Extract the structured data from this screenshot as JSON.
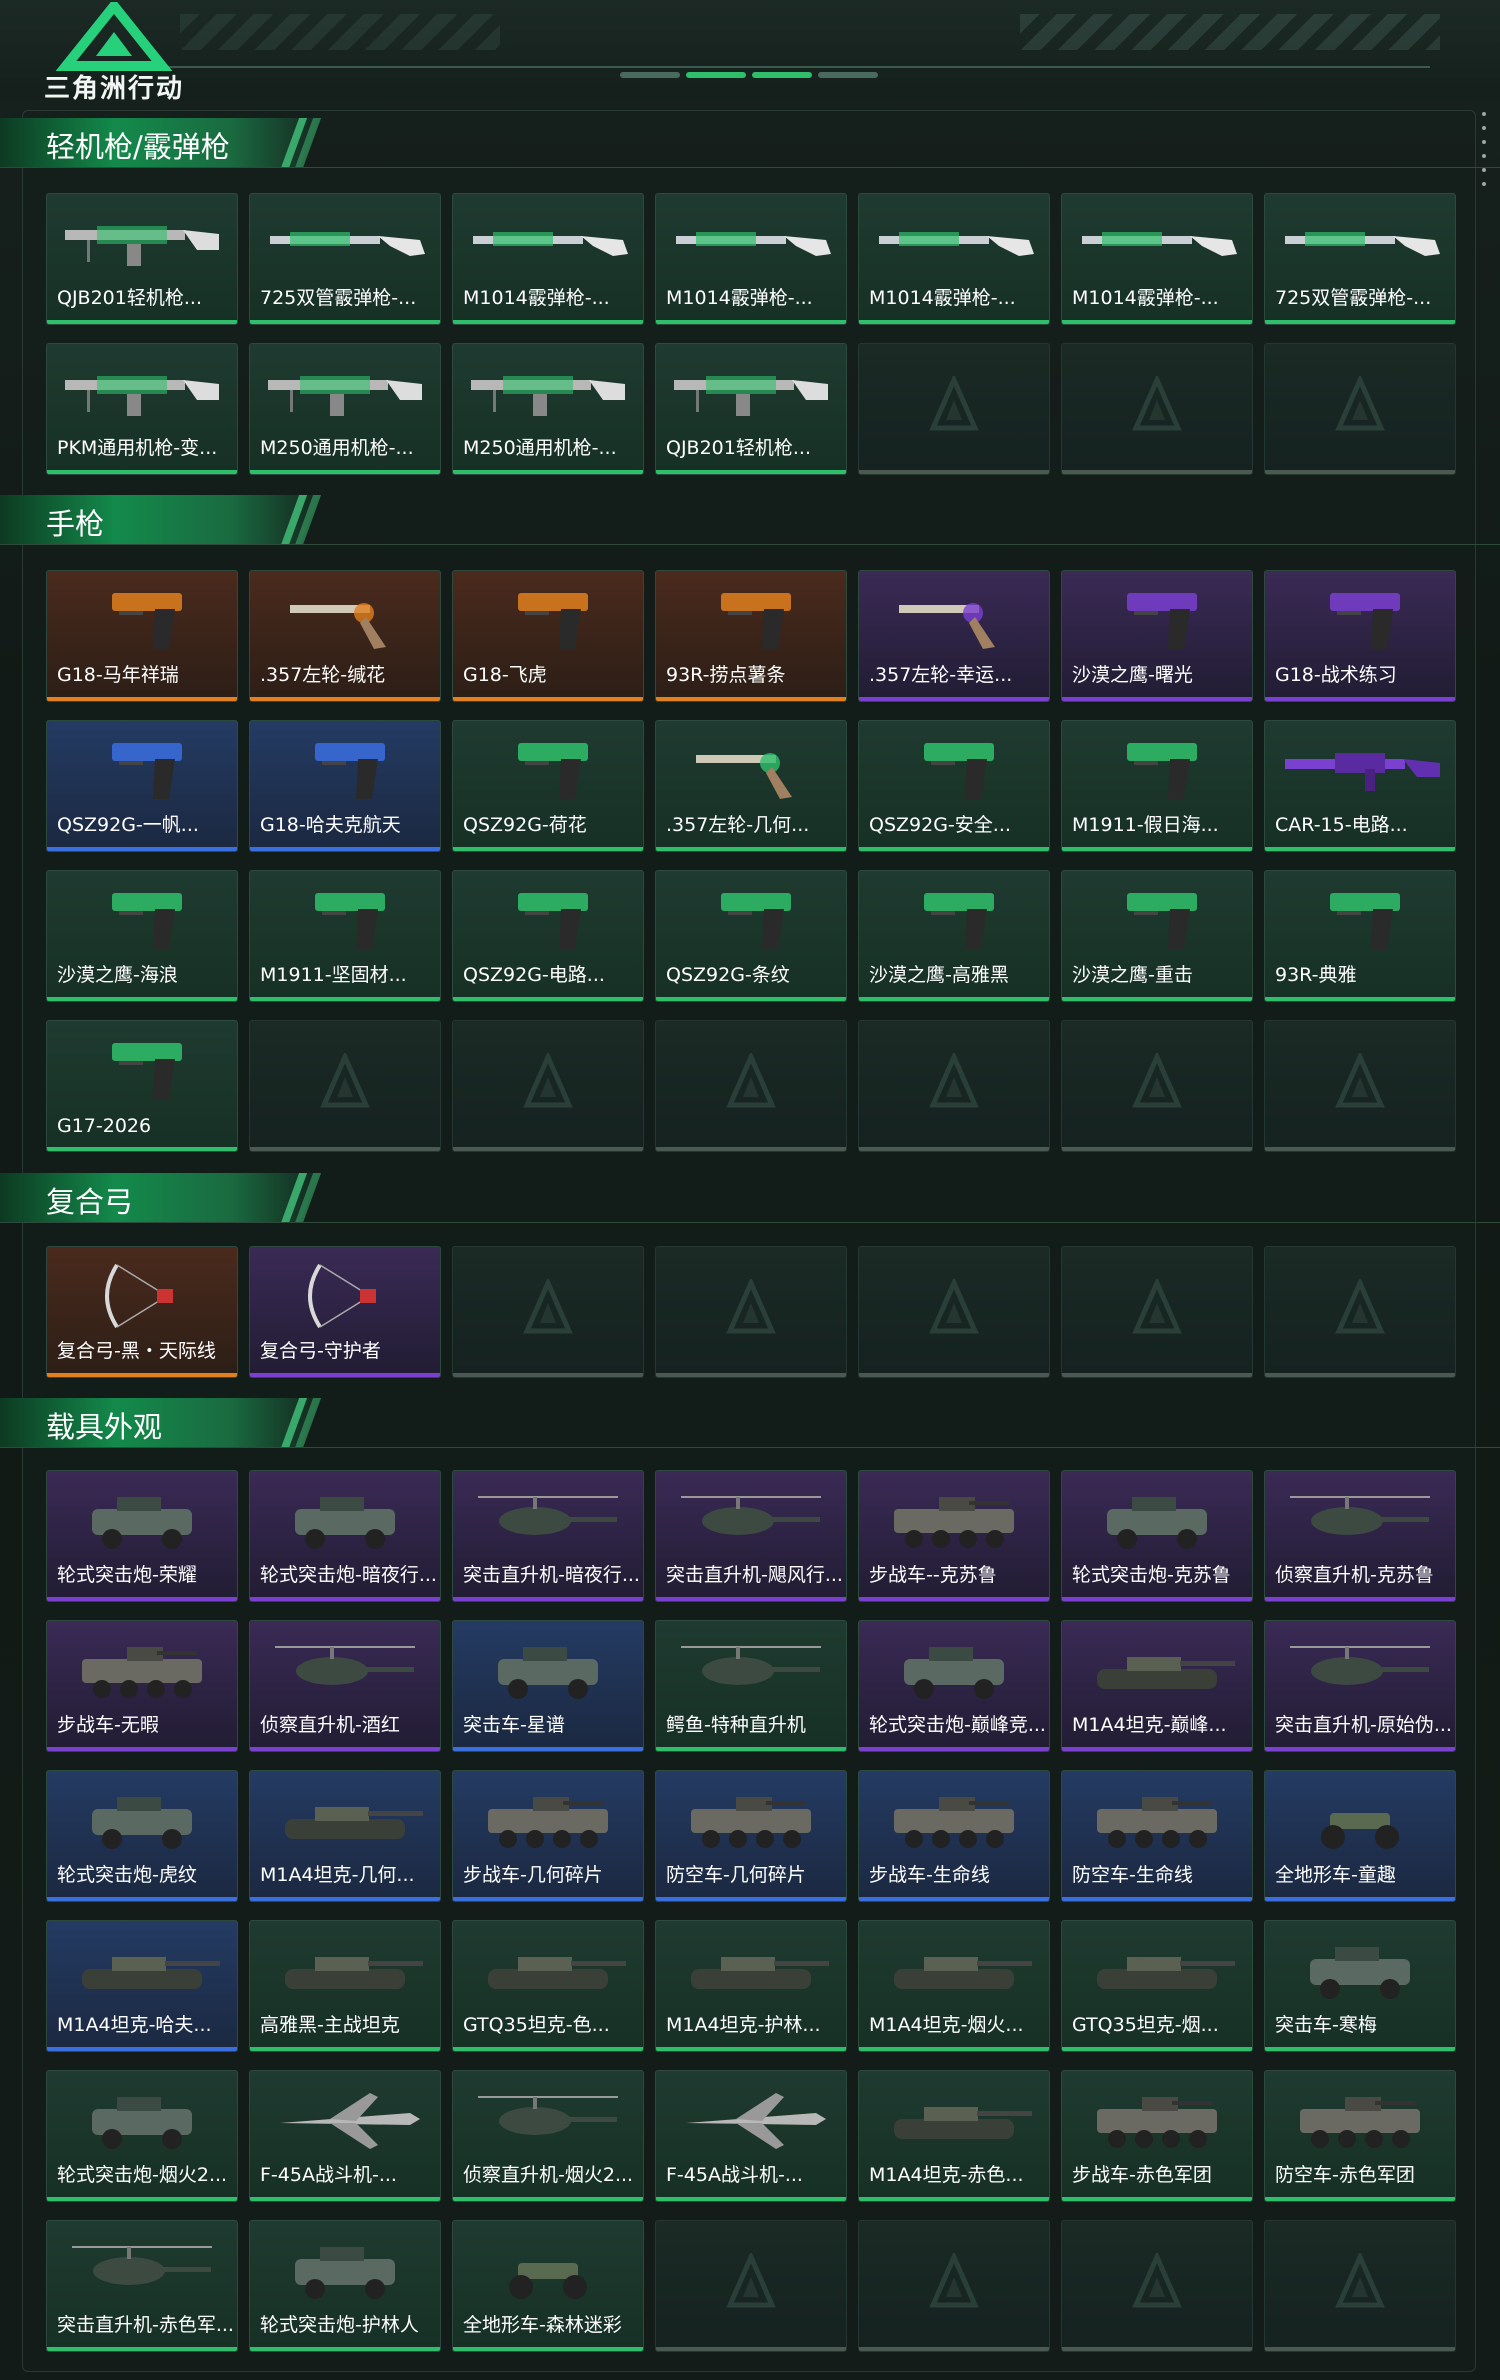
{
  "header": {
    "logo_text": "三角洲行动"
  },
  "colors": {
    "green": "#2fbf6b",
    "orange": "#e0801e",
    "purple": "#7a40d0",
    "blue": "#3a6fe0",
    "accent": "#138a4b"
  },
  "sections": [
    {
      "title": "轻机枪/霰弹枪",
      "items": [
        {
          "name": "QJB201轻机枪...",
          "rarity": "green",
          "kind": "lmg"
        },
        {
          "name": "725双管霰弹枪-...",
          "rarity": "green",
          "kind": "shotgun"
        },
        {
          "name": "M1014霰弹枪-...",
          "rarity": "green",
          "kind": "shotgun"
        },
        {
          "name": "M1014霰弹枪-...",
          "rarity": "green",
          "kind": "shotgun"
        },
        {
          "name": "M1014霰弹枪-...",
          "rarity": "green",
          "kind": "shotgun"
        },
        {
          "name": "M1014霰弹枪-...",
          "rarity": "green",
          "kind": "shotgun"
        },
        {
          "name": "725双管霰弹枪-...",
          "rarity": "green",
          "kind": "shotgun"
        },
        {
          "name": "PKM通用机枪-变...",
          "rarity": "green",
          "kind": "lmg"
        },
        {
          "name": "M250通用机枪-...",
          "rarity": "green",
          "kind": "lmg"
        },
        {
          "name": "M250通用机枪-...",
          "rarity": "green",
          "kind": "lmg"
        },
        {
          "name": "QJB201轻机枪...",
          "rarity": "green",
          "kind": "lmg"
        }
      ],
      "slots": 14
    },
    {
      "title": "手枪",
      "items": [
        {
          "name": "G18-马年祥瑞",
          "rarity": "orange",
          "kind": "pistol"
        },
        {
          "name": ".357左轮-缄花",
          "rarity": "orange",
          "kind": "revolver"
        },
        {
          "name": "G18-飞虎",
          "rarity": "orange",
          "kind": "pistol"
        },
        {
          "name": "93R-捞点薯条",
          "rarity": "orange",
          "kind": "pistol"
        },
        {
          "name": ".357左轮-幸运...",
          "rarity": "purple",
          "kind": "revolver"
        },
        {
          "name": "沙漠之鹰-曙光",
          "rarity": "purple",
          "kind": "pistol"
        },
        {
          "name": "G18-战术练习",
          "rarity": "purple",
          "kind": "pistol"
        },
        {
          "name": "QSZ92G-一帆...",
          "rarity": "blue",
          "kind": "pistol"
        },
        {
          "name": "G18-哈夫克航天",
          "rarity": "blue",
          "kind": "pistol"
        },
        {
          "name": "QSZ92G-荷花",
          "rarity": "green",
          "kind": "pistol"
        },
        {
          "name": ".357左轮-几何...",
          "rarity": "green",
          "kind": "revolver"
        },
        {
          "name": "QSZ92G-安全...",
          "rarity": "green",
          "kind": "pistol"
        },
        {
          "name": "M1911-假日海...",
          "rarity": "green",
          "kind": "pistol"
        },
        {
          "name": "CAR-15-电路...",
          "rarity": "green",
          "kind": "rifle"
        },
        {
          "name": "沙漠之鹰-海浪",
          "rarity": "green",
          "kind": "pistol"
        },
        {
          "name": "M1911-坚固材...",
          "rarity": "green",
          "kind": "pistol"
        },
        {
          "name": "QSZ92G-电路...",
          "rarity": "green",
          "kind": "pistol"
        },
        {
          "name": "QSZ92G-条纹",
          "rarity": "green",
          "kind": "pistol"
        },
        {
          "name": "沙漠之鹰-高雅黑",
          "rarity": "green",
          "kind": "pistol"
        },
        {
          "name": "沙漠之鹰-重击",
          "rarity": "green",
          "kind": "pistol"
        },
        {
          "name": "93R-典雅",
          "rarity": "green",
          "kind": "pistol"
        },
        {
          "name": "G17-2026",
          "rarity": "green",
          "kind": "pistol"
        }
      ],
      "slots": 28
    },
    {
      "title": "复合弓",
      "items": [
        {
          "name": "复合弓-黑・天际线",
          "rarity": "orange",
          "kind": "bow"
        },
        {
          "name": "复合弓-守护者",
          "rarity": "purple",
          "kind": "bow"
        }
      ],
      "slots": 7
    },
    {
      "title": "载具外观",
      "items": [
        {
          "name": "轮式突击炮-荣耀",
          "rarity": "purple",
          "kind": "car"
        },
        {
          "name": "轮式突击炮-暗夜行...",
          "rarity": "purple",
          "kind": "car"
        },
        {
          "name": "突击直升机-暗夜行...",
          "rarity": "purple",
          "kind": "heli"
        },
        {
          "name": "突击直升机-飓风行...",
          "rarity": "purple",
          "kind": "heli"
        },
        {
          "name": "步战车--克苏鲁",
          "rarity": "purple",
          "kind": "apc"
        },
        {
          "name": "轮式突击炮-克苏鲁",
          "rarity": "purple",
          "kind": "car"
        },
        {
          "name": "侦察直升机-克苏鲁",
          "rarity": "purple",
          "kind": "heli"
        },
        {
          "name": "步战车-无暇",
          "rarity": "purple",
          "kind": "apc"
        },
        {
          "name": "侦察直升机-酒红",
          "rarity": "purple",
          "kind": "heli"
        },
        {
          "name": "突击车-星谱",
          "rarity": "blue",
          "kind": "car"
        },
        {
          "name": "鳄鱼-特种直升机",
          "rarity": "green",
          "kind": "heli"
        },
        {
          "name": "轮式突击炮-巅峰竞...",
          "rarity": "purple",
          "kind": "car"
        },
        {
          "name": "M1A4坦克-巅峰...",
          "rarity": "purple",
          "kind": "tank"
        },
        {
          "name": "突击直升机-原始伪...",
          "rarity": "purple",
          "kind": "heli"
        },
        {
          "name": "轮式突击炮-虎纹",
          "rarity": "blue",
          "kind": "car"
        },
        {
          "name": "M1A4坦克-几何...",
          "rarity": "blue",
          "kind": "tank"
        },
        {
          "name": "步战车-几何碎片",
          "rarity": "blue",
          "kind": "apc"
        },
        {
          "name": "防空车-几何碎片",
          "rarity": "blue",
          "kind": "apc"
        },
        {
          "name": "步战车-生命线",
          "rarity": "blue",
          "kind": "apc"
        },
        {
          "name": "防空车-生命线",
          "rarity": "blue",
          "kind": "apc"
        },
        {
          "name": "全地形车-童趣",
          "rarity": "blue",
          "kind": "atv"
        },
        {
          "name": "M1A4坦克-哈夫...",
          "rarity": "blue",
          "kind": "tank"
        },
        {
          "name": "高雅黑-主战坦克",
          "rarity": "green",
          "kind": "tank"
        },
        {
          "name": "GTQ35坦克-色...",
          "rarity": "green",
          "kind": "tank"
        },
        {
          "name": "M1A4坦克-护林...",
          "rarity": "green",
          "kind": "tank"
        },
        {
          "name": "M1A4坦克-烟火...",
          "rarity": "green",
          "kind": "tank"
        },
        {
          "name": "GTQ35坦克-烟...",
          "rarity": "green",
          "kind": "tank"
        },
        {
          "name": "突击车-寒梅",
          "rarity": "green",
          "kind": "car"
        },
        {
          "name": "轮式突击炮-烟火2...",
          "rarity": "green",
          "kind": "car"
        },
        {
          "name": "F-45A战斗机-...",
          "rarity": "green",
          "kind": "jet"
        },
        {
          "name": "侦察直升机-烟火2...",
          "rarity": "green",
          "kind": "heli"
        },
        {
          "name": "F-45A战斗机-...",
          "rarity": "green",
          "kind": "jet"
        },
        {
          "name": "M1A4坦克-赤色...",
          "rarity": "green",
          "kind": "tank"
        },
        {
          "name": "步战车-赤色军团",
          "rarity": "green",
          "kind": "apc"
        },
        {
          "name": "防空车-赤色军团",
          "rarity": "green",
          "kind": "apc"
        },
        {
          "name": "突击直升机-赤色军...",
          "rarity": "green",
          "kind": "heli"
        },
        {
          "name": "轮式突击炮-护林人",
          "rarity": "green",
          "kind": "car"
        },
        {
          "name": "全地形车-森林迷彩",
          "rarity": "green",
          "kind": "atv"
        }
      ],
      "slots": 42
    }
  ]
}
